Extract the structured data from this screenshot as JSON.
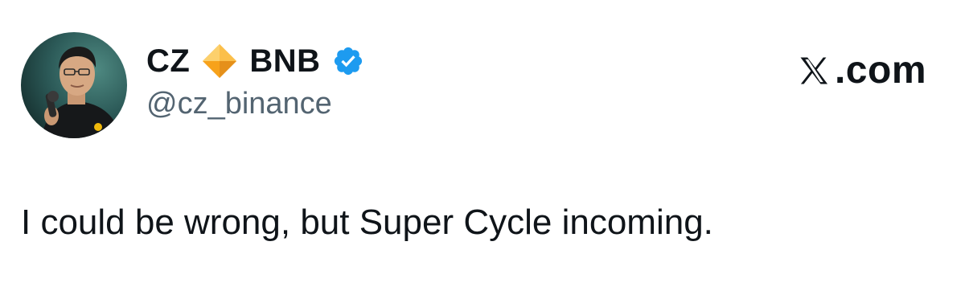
{
  "tweet": {
    "author": {
      "display_name_prefix": "CZ",
      "display_name_suffix": "BNB",
      "handle": "@cz_binance",
      "emoji_icon": "orange-diamond-icon",
      "verified_icon": "verified-badge-icon"
    },
    "source": {
      "logo_icon": "x-logo-icon",
      "domain_suffix": ".com"
    },
    "text": "I could be wrong, but Super Cycle incoming."
  },
  "colors": {
    "text": "#0f1419",
    "handle": "#536471",
    "verified": "#1d9bf0",
    "diamond": "#f7a21b"
  }
}
